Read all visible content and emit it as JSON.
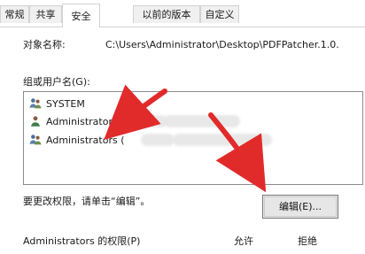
{
  "tabs": [
    {
      "label": "常规"
    },
    {
      "label": "共享"
    },
    {
      "label": "安全",
      "active": true
    },
    {
      "label": "以前的版本"
    },
    {
      "label": "自定义"
    }
  ],
  "object_name": {
    "label": "对象名称:",
    "value": "C:\\Users\\Administrator\\Desktop\\PDFPatcher.1.0."
  },
  "group_users": {
    "label": "组或用户名(G):",
    "items": [
      {
        "label": "SYSTEM",
        "icon": "group-icon"
      },
      {
        "label": "Administrator (",
        "icon": "user-icon"
      },
      {
        "label": "Administrators (",
        "icon": "group-icon"
      }
    ]
  },
  "change_permissions": {
    "text": "要更改权限，请单击“编辑”。",
    "button_label": "编辑(E)..."
  },
  "permissions": {
    "title": "Administrators 的权限(P)",
    "allow": "允许",
    "deny": "拒绝"
  },
  "colors": {
    "arrow": "#e12b2b",
    "border": "#d2d2d2",
    "accent": "#f0f0f0"
  }
}
